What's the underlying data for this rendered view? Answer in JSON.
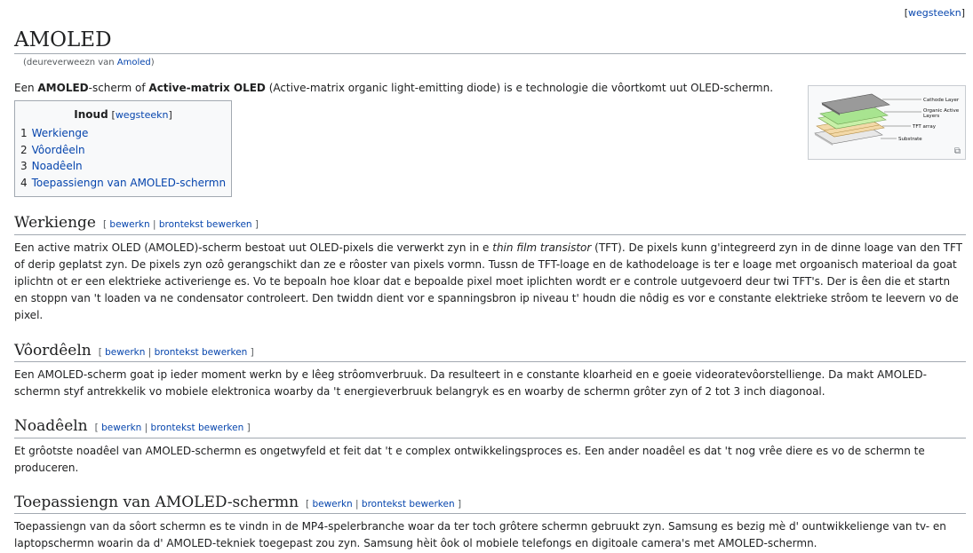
{
  "top_edit": "wegsteekn",
  "title": "AMOLED",
  "redirect": {
    "prefix": "(deureverweezn van ",
    "link": "Amoled",
    "suffix": ")"
  },
  "intro": {
    "p1": "Een ",
    "b1": "AMOLED",
    "p2": "-scherm of ",
    "b2": "Active-matrix OLED",
    "p3": " (Active-matrix organic light-emitting diode) is e technologie die vôortkomt uut OLED-schermn."
  },
  "figure": {
    "labels": [
      "Cathode Layer",
      "Organic Active",
      "Layers",
      "TFT array",
      "Substrate"
    ]
  },
  "toc": {
    "title": "Inoud",
    "edit": "wegsteekn",
    "items": [
      {
        "num": "1",
        "label": "Werkienge"
      },
      {
        "num": "2",
        "label": "Vôordêeln"
      },
      {
        "num": "3",
        "label": "Noadêeln"
      },
      {
        "num": "4",
        "label": "Toepassiengn van AMOLED-schermn"
      }
    ]
  },
  "edit_links": {
    "edit": "bewerkn",
    "source": "brontekst bewerken"
  },
  "sections": [
    {
      "title": "Werkienge",
      "text_a": "Een active matrix OLED (AMOLED)-scherm bestoat uut OLED-pixels die verwerkt zyn in e ",
      "text_em": "thin film transistor",
      "text_b": " (TFT). De pixels kunn g'integreerd zyn in de dinne loage van den TFT of derip geplatst zyn. De pixels zyn ozô gerangschikt dan ze e rôoster van pixels vormn. Tussn de TFT-loage en de kathodeloage is ter e loage met orgoanisch materioal da goat iplichtn ot er een elektrieke activerienge es. Vo te bepoaln hoe kloar dat e bepoalde pixel moet iplichten wordt er e controle uutgevoerd deur twi TFT's. Der is êen die et startn en stoppn van 't loaden va ne condensator controleert. Den twiddn dient vor e spanningsbron ip niveau t' houdn die nôdig es vor e constante elektrieke strôom te leevern vo de pixel."
    },
    {
      "title": "Vôordêeln",
      "text": "Een AMOLED-scherm goat ip ieder moment werkn by e lêeg strôomverbruuk. Da resulteert in e constante kloarheid en e goeie videoratevôorstellienge. Da makt AMOLED-schermn styf antrekkelik vo mobiele elektronica woarby da 't energieverbruuk belangryk es en woarby de schermn grôter zyn of 2 tot 3 inch diagonoal."
    },
    {
      "title": "Noadêeln",
      "text": "Et grôotste noadêel van AMOLED-schermn es ongetwyfeld et feit dat 't e complex ontwikkelingsproces es. Een ander noadêel es dat 't nog vrêe diere es vo de schermn te produceren."
    },
    {
      "title": "Toepassiengn van AMOLED-schermn",
      "text": "Toepassiengn van da sôort schermn es te vindn in de MP4-spelerbranche woar da ter toch grôtere schermn gebruukt zyn. Samsung es bezig mè d' ountwikkelienge van tv- en laptopschermn woarin da d' AMOLED-tekniek toegepast zou zyn. Samsung hèit ôok ol mobiele telefongs en digitoale camera's met AMOLED-schermn."
    }
  ]
}
